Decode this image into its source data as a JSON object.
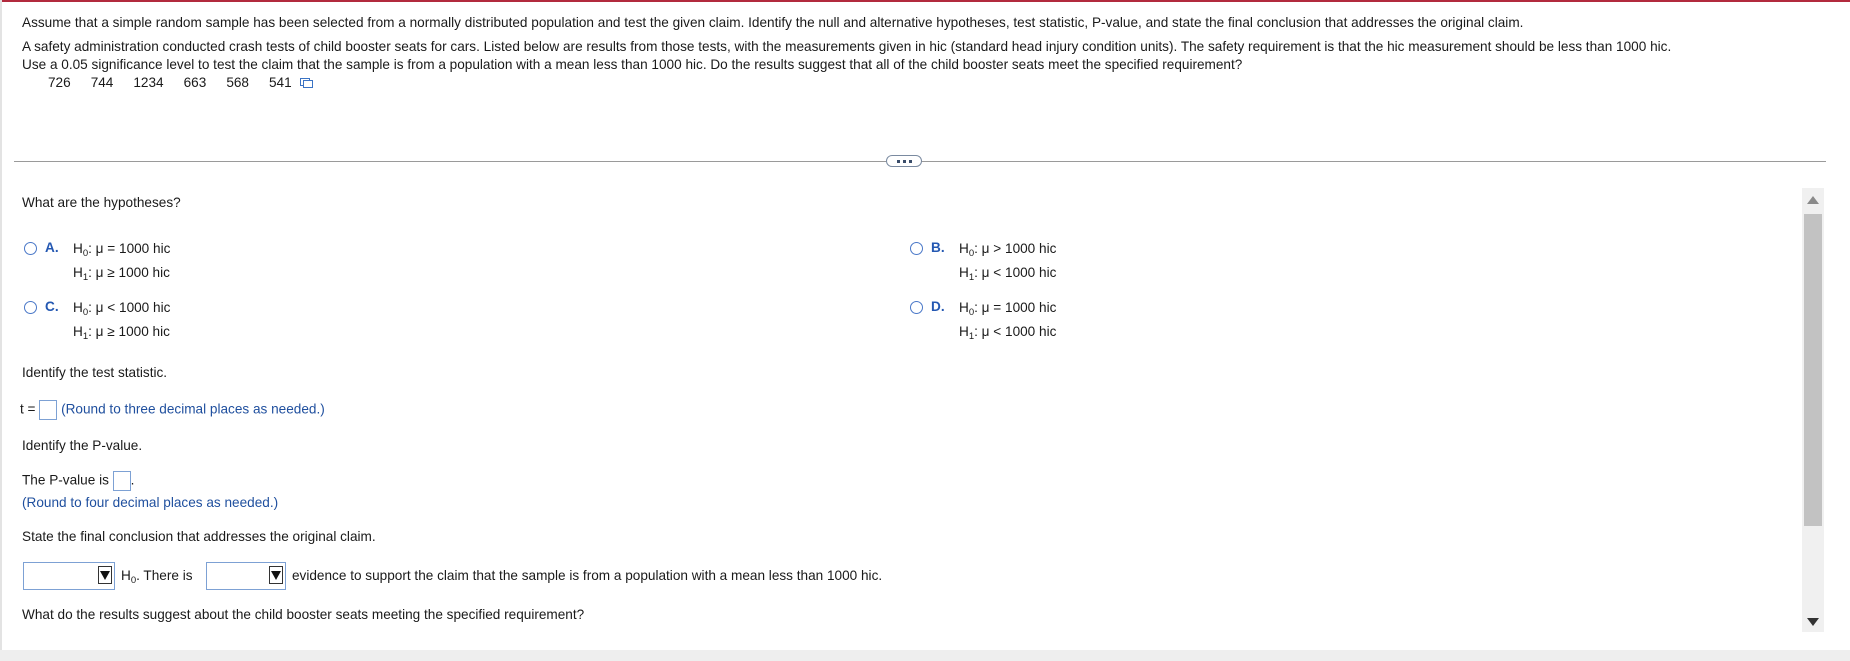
{
  "intro": {
    "line1": "Assume that a simple random sample has been selected from a normally distributed population and test the given claim. Identify the null and alternative hypotheses, test statistic, P-value, and state the final conclusion that addresses the original claim.",
    "line2": "A safety administration conducted crash tests of child booster seats for cars. Listed below are results from those tests, with the measurements given in hic (standard head injury condition units). The safety requirement is that the hic measurement should be less than 1000 hic.",
    "line3": "Use a 0.05 significance level to test the claim that the sample is from a population with a mean less than 1000 hic. Do the results suggest that all of the child booster seats meet the specified requirement?",
    "values": [
      "726",
      "744",
      "1234",
      "663",
      "568",
      "541"
    ]
  },
  "hypotheses": {
    "question": "What are the hypotheses?",
    "options": [
      {
        "letter": "A.",
        "h0": ": μ = 1000 hic",
        "h1": ": μ ≥ 1000 hic"
      },
      {
        "letter": "B.",
        "h0": ": μ > 1000 hic",
        "h1": ": μ < 1000 hic"
      },
      {
        "letter": "C.",
        "h0": ": μ < 1000 hic",
        "h1": ": μ ≥ 1000 hic"
      },
      {
        "letter": "D.",
        "h0": ": μ = 1000 hic",
        "h1": ": μ < 1000 hic"
      }
    ]
  },
  "symbols": {
    "H": "H",
    "sub0": "0",
    "sub1": "1"
  },
  "test_statistic": {
    "question": "Identify the test statistic.",
    "prefix": "t =",
    "hint": "(Round to three decimal places as needed.)",
    "value": ""
  },
  "p_value": {
    "question": "Identify the P-value.",
    "prefix": "The P-value is",
    "suffix": ".",
    "hint": "(Round to four decimal places as needed.)",
    "value": ""
  },
  "conclusion": {
    "question": "State the final conclusion that addresses the original claim.",
    "dropdown1_value": "",
    "mid_text": ". There is",
    "dropdown2_value": "",
    "tail_text": "evidence to support the claim that the sample is from a population with a mean less than 1000 hic."
  },
  "requirement": {
    "question": "What do the results suggest about the child booster seats meeting the specified requirement?"
  },
  "icons": {
    "data-table": "data-table-icon",
    "expand": "ellipsis-icon",
    "scroll-up": "scroll-up-icon",
    "scroll-down": "scroll-down-icon"
  },
  "colors": {
    "accent_top": "#b22a3d",
    "link_blue": "#1f4f9e",
    "radio_blue": "#4a78c8"
  }
}
